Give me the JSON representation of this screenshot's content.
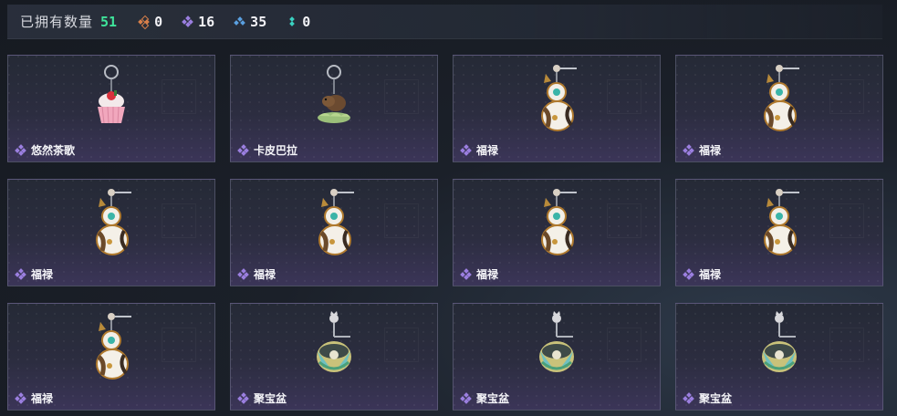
{
  "header": {
    "owned_label": "已拥有数量",
    "owned_count": "51",
    "stats": [
      {
        "icon": "orange-diamond-icon",
        "value": "0",
        "color": "#d9804a"
      },
      {
        "icon": "purple-diamond-icon",
        "value": "16",
        "color": "#9b7fe0"
      },
      {
        "icon": "blue-diamond-icon",
        "value": "35",
        "color": "#5aa0e0"
      },
      {
        "icon": "teal-diamond-icon",
        "value": "0",
        "color": "#3ad0c0"
      }
    ]
  },
  "items": [
    {
      "name": "悠然茶歌",
      "type": "cupcake"
    },
    {
      "name": "卡皮巴拉",
      "type": "capybara"
    },
    {
      "name": "福禄",
      "type": "gourd"
    },
    {
      "name": "福禄",
      "type": "gourd"
    },
    {
      "name": "福禄",
      "type": "gourd"
    },
    {
      "name": "福禄",
      "type": "gourd"
    },
    {
      "name": "福禄",
      "type": "gourd"
    },
    {
      "name": "福禄",
      "type": "gourd"
    },
    {
      "name": "福禄",
      "type": "gourd"
    },
    {
      "name": "聚宝盆",
      "type": "bowl"
    },
    {
      "name": "聚宝盆",
      "type": "bowl"
    },
    {
      "name": "聚宝盆",
      "type": "bowl"
    }
  ],
  "rarity_color": "#9b7fe0"
}
